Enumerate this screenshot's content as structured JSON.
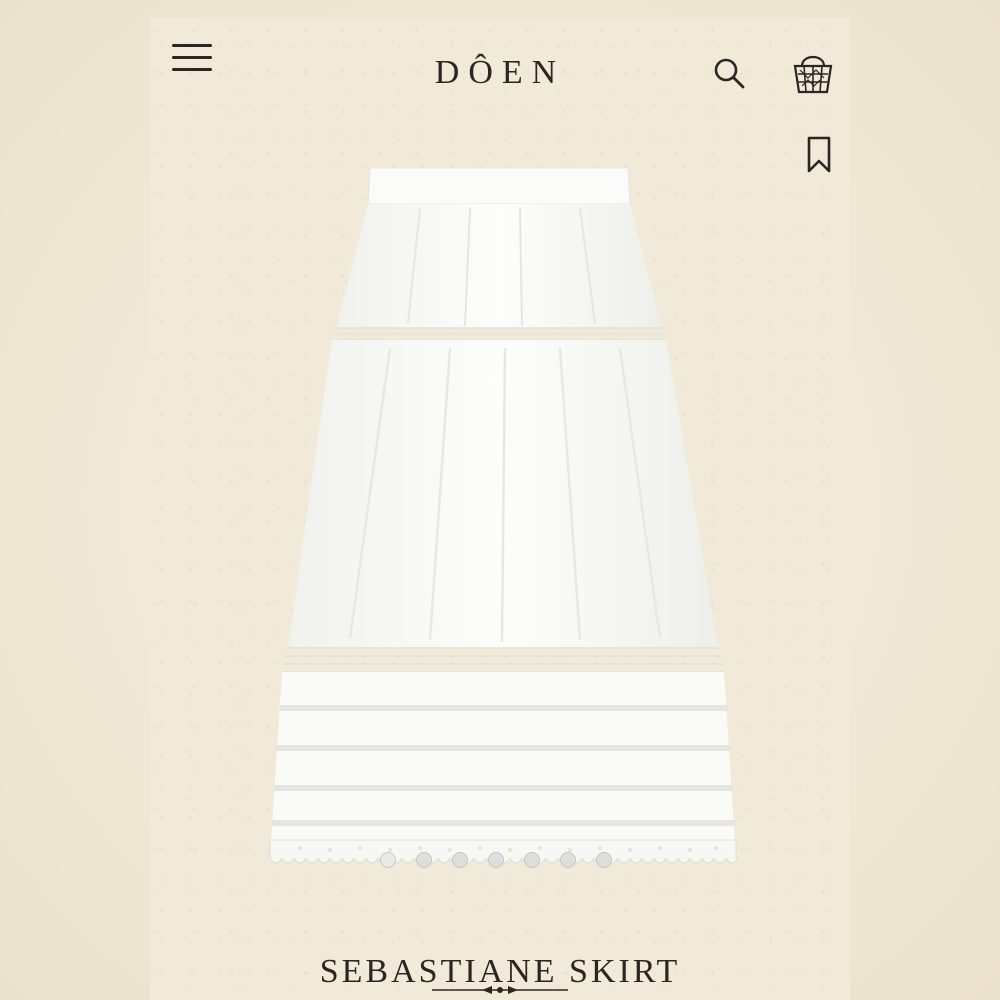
{
  "header": {
    "brand": "DÔEN",
    "menu_icon": "hamburger-menu-icon",
    "search_icon": "search-icon",
    "cart_icon": "basket-icon",
    "wishlist_icon": "bookmark-icon"
  },
  "product": {
    "title": "SEBASTIANE SKIRT",
    "image_alt_icon": "white-tiered-skirt",
    "carousel": {
      "total": 7,
      "active_index": 0
    }
  },
  "colors": {
    "background": "#f1ead8",
    "ink": "#2b2622",
    "garment": "#fbfbf8"
  }
}
